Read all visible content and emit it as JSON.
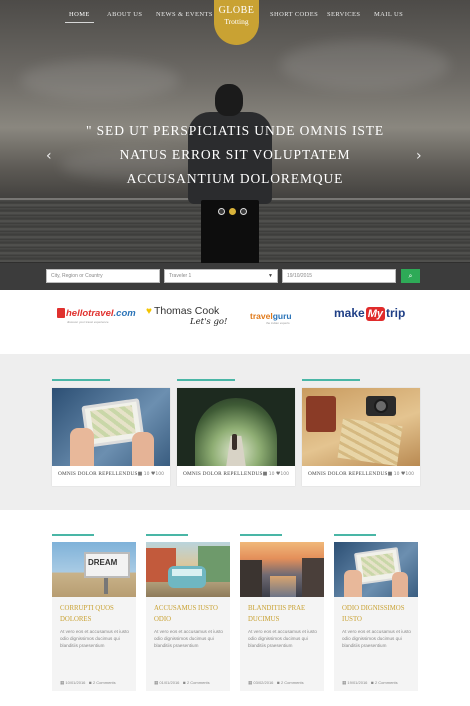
{
  "nav": {
    "items": [
      {
        "label": "Home"
      },
      {
        "label": "About Us"
      },
      {
        "label": "News & Events"
      },
      {
        "label": "Short Codes"
      },
      {
        "label": "Services"
      },
      {
        "label": "Mail Us"
      }
    ],
    "logo_line1": "GLOBE",
    "logo_line2": "Trotting"
  },
  "hero": {
    "slogan": "\" Sed ut perspiciatis unde omnis iste natus error sit voluptatem accusantium doloremque",
    "prev": "‹",
    "next": "›"
  },
  "search": {
    "region_placeholder": "City, Region or Country",
    "travelers_value": "Traveler 1",
    "date_value": "19/10/2015",
    "search_icon": "search-icon"
  },
  "partners": {
    "hello_main": "hellotravel",
    "hello_suffix": ".com",
    "hello_tag": "discover your travel experience",
    "thomas_main": "Thomas Cook",
    "thomas_sub": "Let's go!",
    "guru_a": "travel",
    "guru_b": "guru",
    "guru_tag": "the indian experts",
    "mmt_a": "make",
    "mmt_my": "My",
    "mmt_b": "trip"
  },
  "featured": [
    {
      "caption": "Omnis Dolor Repellendus",
      "views": "10",
      "likes": "100"
    },
    {
      "caption": "Omnis Dolor Repellendus",
      "views": "10",
      "likes": "100"
    },
    {
      "caption": "Omnis Dolor Repellendus",
      "views": "10",
      "likes": "100"
    }
  ],
  "posts": [
    {
      "title": "Corrupti quos dolores",
      "excerpt": "At vero eos et accusamus et iusto odio dignissimos ducimus qui blanditiis praesentium",
      "date": "10/01/2016",
      "comments": "2 Comments"
    },
    {
      "title": "Accusamus iusto odio",
      "excerpt": "At vero eos et accusamus et iusto odio dignissimos ducimus qui blanditiis praesentium",
      "date": "01/01/2016",
      "comments": "2 Comments"
    },
    {
      "title": "Blanditiis prae ducimus",
      "excerpt": "At vero eos et accusamus et iusto odio dignissimos ducimus qui blanditiis praesentium",
      "date": "03/02/2016",
      "comments": "2 Comments"
    },
    {
      "title": "Odio dignissimos iusto",
      "excerpt": "At vero eos et accusamus et iusto odio dignissimos ducimus qui blanditiis praesentium",
      "date": "19/01/2016",
      "comments": "2 Comments"
    }
  ],
  "colors": {
    "accent_gold": "#c9a233",
    "teal_line": "#49b6a6",
    "search_green": "#2eaa57",
    "dark_bar": "#3c3c3c"
  }
}
